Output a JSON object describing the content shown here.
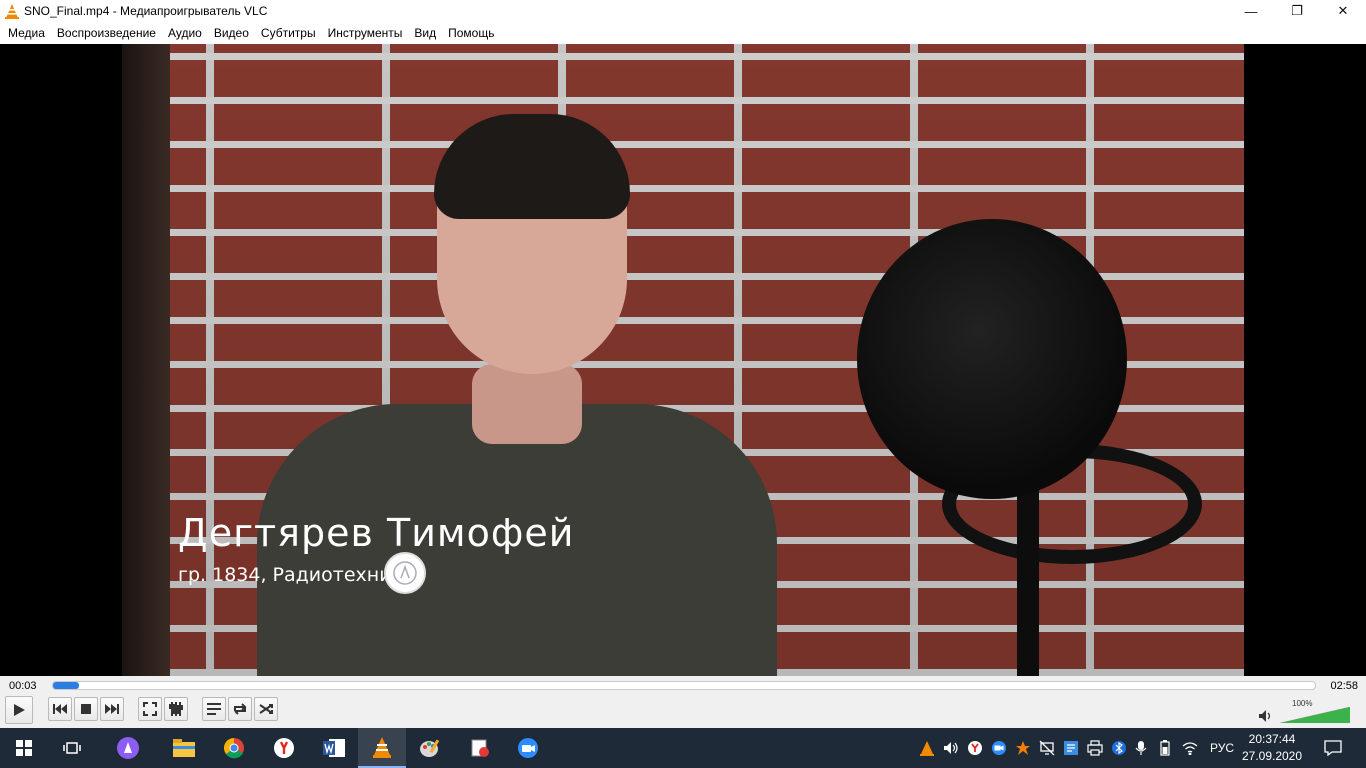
{
  "window": {
    "title": "SNO_Final.mp4 - Медиапроигрыватель VLC",
    "minimize": "—",
    "maximize": "❐",
    "close": "✕"
  },
  "menu": {
    "items": [
      "Медиа",
      "Воспроизведение",
      "Аудио",
      "Видео",
      "Субтитры",
      "Инструменты",
      "Вид",
      "Помощь"
    ]
  },
  "video": {
    "caption_name": "Дегтярев Тимофей",
    "caption_subtitle": "гр. 1834, Радиотехни"
  },
  "playback": {
    "current_time": "00:03",
    "total_time": "02:58",
    "progress_fraction": 0.02,
    "volume_label": "100%",
    "volume_fraction": 1.0
  },
  "controls": {
    "buttons": [
      "play-icon",
      "previous-icon",
      "stop-icon",
      "next-icon",
      "fullscreen-icon",
      "extended-settings-icon",
      "playlist-icon",
      "loop-icon",
      "shuffle-icon"
    ]
  },
  "taskbar": {
    "apps": [
      "windows-start-icon",
      "task-view-icon",
      "alice-icon",
      "file-explorer-icon",
      "chrome-icon",
      "yandex-browser-icon",
      "word-icon",
      "vlc-icon",
      "paint-icon",
      "app-icon",
      "zoom-icon"
    ],
    "active_app": "vlc-icon",
    "language": "РУС",
    "time": "20:37:44",
    "date": "27.09.2020"
  },
  "colors": {
    "accent": "#2a7de1",
    "taskbar": "#1e2a38",
    "volume": "#3cb34a",
    "vlc_orange": "#f08a00"
  }
}
